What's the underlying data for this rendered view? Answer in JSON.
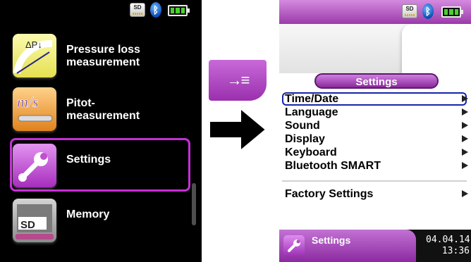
{
  "left_screen": {
    "status": {
      "sd_label": "SD",
      "bluetooth_glyph": "ᛒ",
      "battery_level": 1.0
    },
    "menu": [
      {
        "label": "Pressure loss measurement",
        "icon": "pressure-gauge-icon",
        "icon_text": "ΔP↓",
        "icon_color": "#f3f27a"
      },
      {
        "label": "Pitot-\nmeasurement",
        "icon": "pitot-tube-icon",
        "icon_text": "m/s",
        "icon_color": "#f4a63a"
      },
      {
        "label": "Settings",
        "icon": "wrench-icon",
        "icon_color": "#c14fd2",
        "selected": true
      },
      {
        "label": "Memory",
        "icon": "sd-card-icon",
        "icon_text": "SD",
        "icon_color": "#b1b1b1"
      }
    ]
  },
  "key_button": {
    "glyph": "→≡",
    "color": "#b14cc6"
  },
  "right_screen": {
    "status": {
      "sd_label": "SD",
      "bluetooth_glyph": "ᛒ",
      "battery_level": 1.0
    },
    "title": "Settings",
    "items": [
      {
        "label": "Time/Date",
        "has_submenu": true,
        "selected": true
      },
      {
        "label": "Language",
        "has_submenu": true
      },
      {
        "label": "Sound",
        "has_submenu": true
      },
      {
        "label": "Display",
        "has_submenu": true
      },
      {
        "label": "Keyboard",
        "has_submenu": true
      },
      {
        "label": "Bluetooth SMART",
        "has_submenu": true
      },
      {
        "label": "Factory Settings",
        "has_submenu": true
      }
    ],
    "footer": {
      "tab_label": "Settings",
      "date": "04.04.14",
      "time": "13:36"
    }
  },
  "colors": {
    "accent": "#b14cc6",
    "selection": "#1525a8",
    "left_bg": "#000000"
  }
}
